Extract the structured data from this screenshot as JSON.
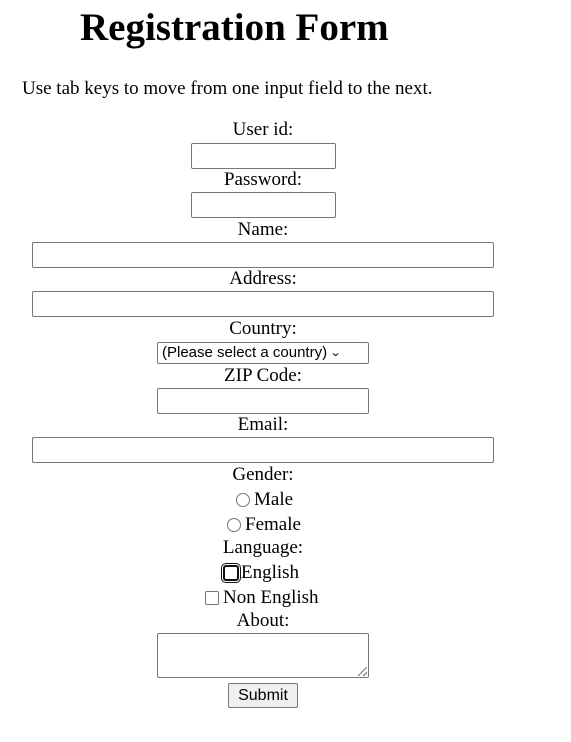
{
  "page": {
    "title": "Registration Form",
    "instructions": "Use tab keys to move from one input field to the next."
  },
  "form": {
    "userid": {
      "label": "User id:",
      "value": ""
    },
    "password": {
      "label": "Password:",
      "value": ""
    },
    "name": {
      "label": "Name:",
      "value": ""
    },
    "address": {
      "label": "Address:",
      "value": ""
    },
    "country": {
      "label": "Country:",
      "selected": "(Please select a country)"
    },
    "zip": {
      "label": "ZIP Code:",
      "value": ""
    },
    "email": {
      "label": "Email:",
      "value": ""
    },
    "gender": {
      "label": "Gender:",
      "options": [
        {
          "label": "Male",
          "checked": false
        },
        {
          "label": "Female",
          "checked": false
        }
      ]
    },
    "language": {
      "label": "Language:",
      "options": [
        {
          "label": "English",
          "checked": false,
          "focused": true
        },
        {
          "label": "Non English",
          "checked": false
        }
      ]
    },
    "about": {
      "label": "About:",
      "value": ""
    },
    "submit_label": "Submit"
  }
}
